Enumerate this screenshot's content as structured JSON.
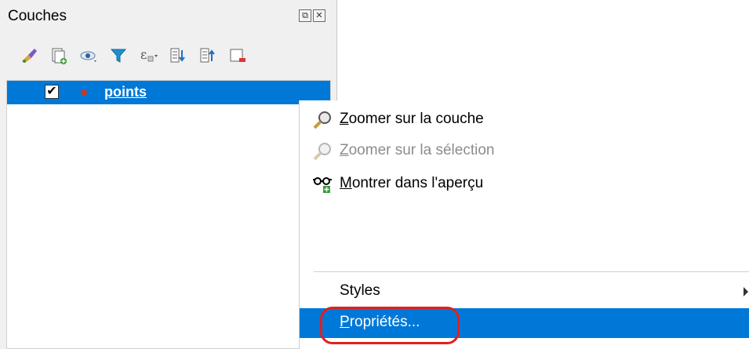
{
  "panel": {
    "title": "Couches",
    "float_icon": "⧉",
    "close_icon": "✕",
    "toolbar": [
      {
        "name": "open-layer-styling-icon"
      },
      {
        "name": "add-group-icon"
      },
      {
        "name": "manage-visibility-icon"
      },
      {
        "name": "filter-legend-icon"
      },
      {
        "name": "filter-expression-icon"
      },
      {
        "name": "expand-all-icon"
      },
      {
        "name": "collapse-all-icon"
      },
      {
        "name": "remove-layer-icon"
      }
    ],
    "layer": {
      "name": "points",
      "checked": "✔"
    }
  },
  "context_menu": {
    "items": [
      {
        "label_first": "Z",
        "label_rest": "oomer sur la couche",
        "icon": "zoom-icon",
        "enabled": true
      },
      {
        "label_first": "Z",
        "label_rest": "oomer sur la sélection",
        "icon": "zoom-icon",
        "enabled": false
      },
      {
        "label_first": "M",
        "label_rest": "ontrer dans l'aperçu",
        "icon": "overview-glasses-icon",
        "enabled": true
      }
    ],
    "styles_label": "Styles",
    "properties_first": "P",
    "properties_rest": "ropriétés..."
  },
  "colors": {
    "selection": "#0078d7",
    "highlight_ring": "#e02020"
  }
}
